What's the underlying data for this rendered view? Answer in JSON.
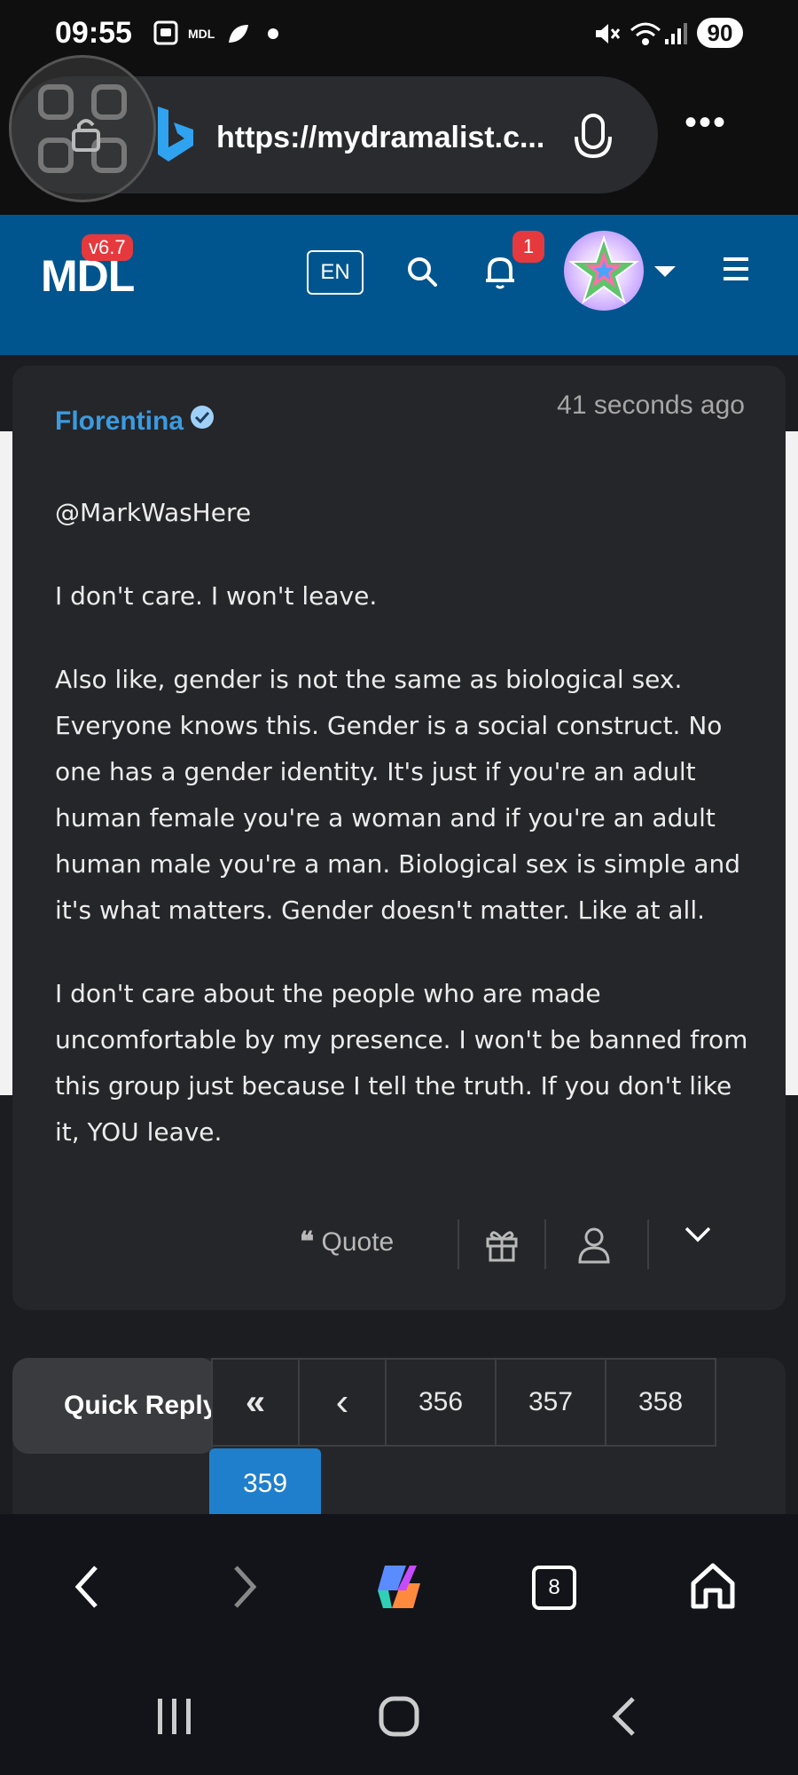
{
  "status_bar": {
    "time": "09:55",
    "app_label": "MDL",
    "battery": "90"
  },
  "browser": {
    "url": "https://mydramalist.c...",
    "tab_count": "8"
  },
  "site_header": {
    "logo": "MDL",
    "version": "v6.7",
    "language": "EN",
    "notification_count": "1"
  },
  "comment": {
    "author": "Florentina",
    "timestamp": "41 seconds ago",
    "paragraphs": [
      "@MarkWasHere",
      "I don't care. I won't leave.",
      "Also like, gender is not the same as biological sex. Everyone knows this. Gender is a social construct. No one has a gender identity. It's just if you're an adult human female you're a woman and if you're an adult human male you're a man. Biological sex is simple and it's what matters. Gender doesn't matter. Like at all.",
      "I don't care about the people who are made uncomfortable by my presence. I won't be banned from this group just because I tell the truth. If you don't like it, YOU leave."
    ],
    "quote_label": "Quote"
  },
  "pagination": {
    "quick_reply": "Quick Reply",
    "first": "«",
    "prev": "‹",
    "pages": [
      "356",
      "357",
      "358"
    ],
    "current": "359"
  },
  "colors": {
    "header_bg": "#00558f",
    "accent": "#3b9be0",
    "badge": "#e6393d",
    "card_bg": "#252629",
    "current_page": "#1f7fcc"
  }
}
